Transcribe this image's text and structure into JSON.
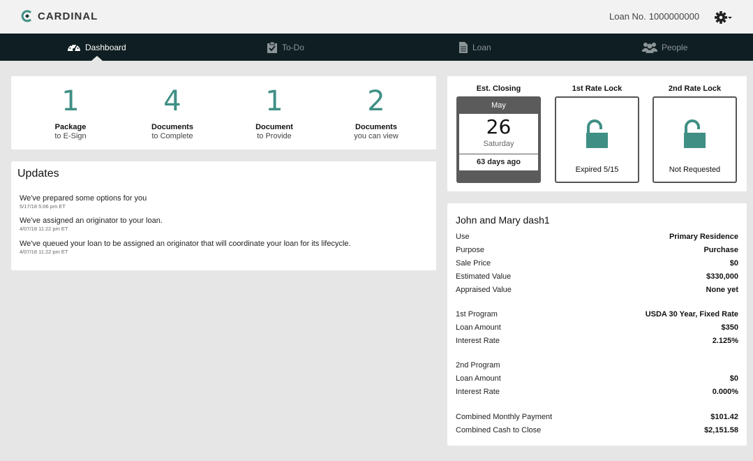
{
  "header": {
    "brand": "CARDINAL",
    "loan_label": "Loan No.",
    "loan_number": "1000000000"
  },
  "nav": [
    {
      "label": "Dashboard",
      "icon": "speedometer-icon",
      "active": true
    },
    {
      "label": "To-Do",
      "icon": "clipboard-check-icon",
      "active": false
    },
    {
      "label": "Loan",
      "icon": "document-icon",
      "active": false
    },
    {
      "label": "People",
      "icon": "people-icon",
      "active": false
    }
  ],
  "stats": [
    {
      "number": "1",
      "title": "Package",
      "sub": "to E-Sign"
    },
    {
      "number": "4",
      "title": "Documents",
      "sub": "to Complete"
    },
    {
      "number": "1",
      "title": "Document",
      "sub": "to Provide"
    },
    {
      "number": "2",
      "title": "Documents",
      "sub": "you can view"
    }
  ],
  "updates": {
    "title": "Updates",
    "items": [
      {
        "message": "We've prepared some options for you",
        "time": "5/17/18 5:06 pm ET"
      },
      {
        "message": "We've assigned an originator to your loan.",
        "time": "4/07/18 11:22 pm ET"
      },
      {
        "message": "We've queued your loan to be assigned an originator that will coordinate your loan for its lifecycle.",
        "time": "4/07/18 11:22 pm ET"
      }
    ]
  },
  "closing": {
    "est_label": "Est. Closing",
    "month": "May",
    "day": "26",
    "weekday": "Saturday",
    "days_ago": "63 days ago",
    "lock1_label": "1st Rate Lock",
    "lock1_status": "Expired 5/15",
    "lock2_label": "2nd Rate Lock",
    "lock2_status": "Not Requested",
    "accent_color": "#3f8f84"
  },
  "details": {
    "name": "John and Mary dash1",
    "rows": [
      {
        "key": "Use",
        "value": "Primary Residence"
      },
      {
        "key": "Purpose",
        "value": "Purchase"
      },
      {
        "key": "Sale Price",
        "value": "$0"
      },
      {
        "key": "Estimated Value",
        "value": "$330,000"
      },
      {
        "key": "Appraised Value",
        "value": "None yet"
      },
      {
        "key": "1st Program",
        "value": "USDA 30 Year, Fixed Rate"
      },
      {
        "key": "Loan Amount",
        "value": "$350"
      },
      {
        "key": "Interest Rate",
        "value": "2.125%"
      },
      {
        "key": "2nd Program",
        "value": ""
      },
      {
        "key": "Loan Amount",
        "value": "$0"
      },
      {
        "key": "Interest Rate",
        "value": "0.000%"
      },
      {
        "key": "Combined Monthly Payment",
        "value": "$101.42"
      },
      {
        "key": "Combined Cash to Close",
        "value": "$2,151.58"
      }
    ]
  }
}
